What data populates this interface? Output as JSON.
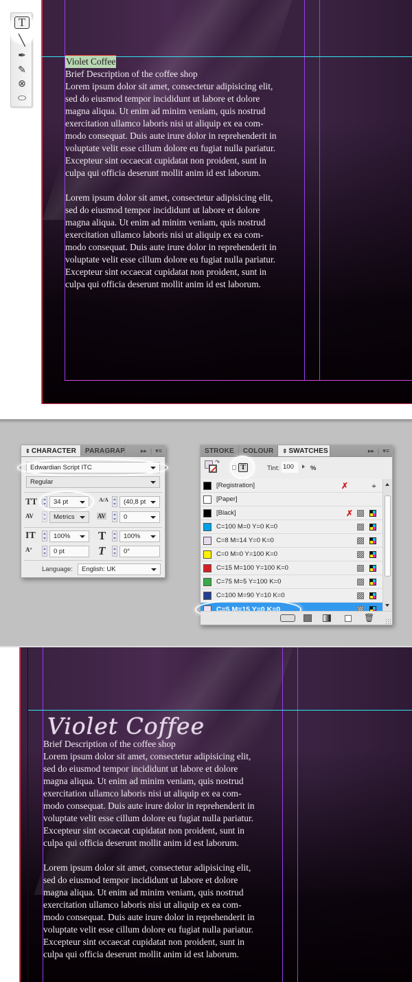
{
  "top_page": {
    "text": {
      "heading": "Violet Coffee",
      "subheading": "Brief Description of the coffee shop",
      "paragraph1": "Lorem ipsum dolor sit amet, consectetur adipisicing elit,\nsed do eiusmod tempor incididunt ut labore et dolore\nmagna aliqua. Ut enim ad minim veniam, quis nostrud\nexercitation ullamco laboris nisi ut aliquip ex ea com-\nmodo consequat. Duis aute irure dolor in reprehenderit in\nvoluptate velit esse cillum dolore eu fugiat nulla pariatur.\nExcepteur sint occaecat cupidatat non proident, sunt in\nculpa qui officia deserunt mollit anim id est laborum.",
      "paragraph2": "Lorem ipsum dolor sit amet, consectetur adipisicing elit,\nsed do eiusmod tempor incididunt ut labore et dolore\nmagna aliqua. Ut enim ad minim veniam, quis nostrud\nexercitation ullamco laboris nisi ut aliquip ex ea com-\nmodo consequat. Duis aute irure dolor in reprehenderit in\nvoluptate velit esse cillum dolore eu fugiat nulla pariatur.\nExcepteur sint occaecat cupidatat non proident, sunt in\nculpa qui officia deserunt mollit anim id est laborum."
    }
  },
  "toolbox": {
    "tools": [
      {
        "name": "type-tool",
        "glyph": "T",
        "active": true
      },
      {
        "name": "line-tool",
        "glyph": "╲"
      },
      {
        "name": "pen-tool",
        "glyph": "✒"
      },
      {
        "name": "pencil-tool",
        "glyph": "✎"
      },
      {
        "name": "rectangle-frame-tool",
        "glyph": "⊗"
      },
      {
        "name": "ellipse-tool",
        "glyph": "⬭"
      }
    ]
  },
  "character_panel": {
    "tabs": [
      {
        "label": "CHARACTER",
        "active": true,
        "arrows": "⇕"
      },
      {
        "label": "PARAGRAPH",
        "active": false
      }
    ],
    "menu_glyphs": {
      "expand": "▸▸",
      "menu": "▾≡"
    },
    "font_family": "Edwardian Script ITC",
    "font_style": "Regular",
    "font_size": "34 pt",
    "leading": "(40,8 pt",
    "kerning": "Metrics",
    "tracking": "0",
    "vertical_scale": "100%",
    "horizontal_scale": "100%",
    "baseline_shift": "0 pt",
    "skew": "0°",
    "language_label": "Language:",
    "language": "English: UK",
    "icons": {
      "size_icon": "TT",
      "leading_icon": "A/A",
      "kerning_icon": "AV",
      "tracking_icon": "AV",
      "vscale_icon": "IT",
      "hscale_icon": "T",
      "baseline_icon": "Aª",
      "skew_icon": "T"
    }
  },
  "swatches_panel": {
    "tabs": [
      {
        "label": "STROKE",
        "active": false
      },
      {
        "label": "COLOUR",
        "active": false
      },
      {
        "label": "SWATCHES",
        "active": true,
        "arrows": "⇕"
      }
    ],
    "menu_glyphs": {
      "expand": "▸▸",
      "menu": "▾≡"
    },
    "tint_label": "Tint:",
    "tint_value": "100",
    "tint_unit": "%",
    "formatting_text_icon": "T",
    "swatches": [
      {
        "name": "[Registration]",
        "color": "#000000",
        "noedit": true,
        "registration": true
      },
      {
        "name": "[Paper]",
        "color": "#ffffff"
      },
      {
        "name": "[Black]",
        "color": "#000000",
        "noedit": true,
        "process": true
      },
      {
        "name": "C=100 M=0 Y=0 K=0",
        "color": "#00a0e6",
        "process": true
      },
      {
        "name": "C=8 M=14 Y=0 K=0",
        "color": "#e6dcee",
        "process": true
      },
      {
        "name": "C=0 M=0 Y=100 K=0",
        "color": "#fff200",
        "process": true
      },
      {
        "name": "C=15 M=100 Y=100 K=0",
        "color": "#d42027",
        "process": true
      },
      {
        "name": "C=75 M=5 Y=100 K=0",
        "color": "#3aa948",
        "process": true
      },
      {
        "name": "C=100 M=90 Y=10 K=0",
        "color": "#233f8f",
        "process": true
      },
      {
        "name": "C=5 M=15 Y=0 K=0",
        "color": "#f0e2f0",
        "process": true,
        "selected": true
      }
    ]
  },
  "bottom_page": {
    "text": {
      "heading": "Violet Coffee",
      "subheading": "Brief Description of the coffee shop",
      "paragraph1": "Lorem ipsum dolor sit amet, consectetur adipisicing elit,\nsed do eiusmod tempor incididunt ut labore et dolore\nmagna aliqua. Ut enim ad minim veniam, quis nostrud\nexercitation ullamco laboris nisi ut aliquip ex ea com-\nmodo consequat. Duis aute irure dolor in reprehenderit in\nvoluptate velit esse cillum dolore eu fugiat nulla pariatur.\nExcepteur sint occaecat cupidatat non proident, sunt in\nculpa qui officia deserunt mollit anim id est laborum.",
      "paragraph2": "Lorem ipsum dolor sit amet, consectetur adipisicing elit,\nsed do eiusmod tempor incididunt ut labore et dolore\nmagna aliqua. Ut enim ad minim veniam, quis nostrud\nexercitation ullamco laboris nisi ut aliquip ex ea com-\nmodo consequat. Duis aute irure dolor in reprehenderit in\nvoluptate velit esse cillum dolore eu fugiat nulla pariatur.\nExcepteur sint occaecat cupidatat non proident, sunt in\nculpa qui officia deserunt mollit anim id est laborum."
    }
  },
  "colors": {
    "guide_vertical": "#9a3cf0",
    "guide_horizontal": "#2ee6f0",
    "bleed": "#e0324a",
    "selection_blue": "#3399ee"
  }
}
